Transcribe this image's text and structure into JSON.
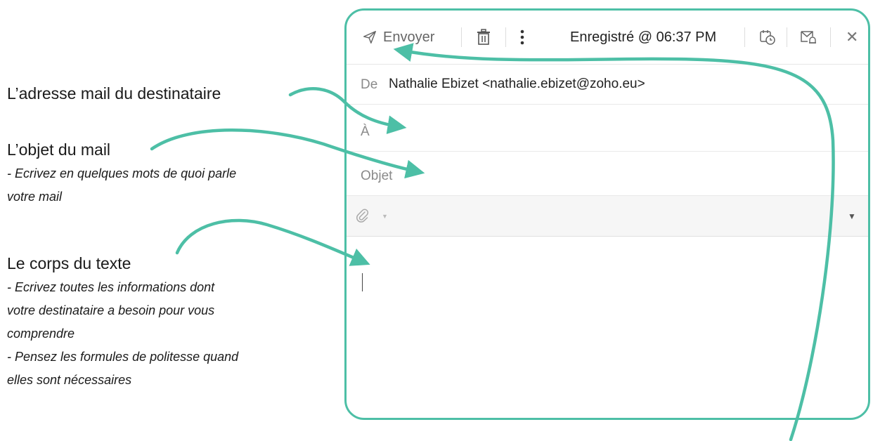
{
  "notes": {
    "recipient": {
      "title": "L’adresse mail du destinataire"
    },
    "subject": {
      "title": "L’objet du mail",
      "lines": [
        "- Ecrivez en quelques mots de quoi parle",
        "votre mail"
      ]
    },
    "body": {
      "title": "Le corps du texte",
      "lines": [
        "- Ecrivez toutes les informations dont",
        "votre destinataire a besoin pour vous",
        "comprendre",
        "- Pensez les formules de politesse quand",
        "elles sont nécessaires"
      ]
    }
  },
  "compose": {
    "toolbar": {
      "send_label": "Envoyer",
      "saved_status": "Enregistré @ 06:37 PM"
    },
    "from": {
      "label": "De",
      "value": "Nathalie Ebizet <nathalie.ebizet@zoho.eu>"
    },
    "to": {
      "label": "À",
      "value": ""
    },
    "subject": {
      "label": "Objet",
      "value": ""
    },
    "body": {
      "value": ""
    }
  },
  "colors": {
    "accent": "#4dbfa6",
    "muted_text": "#8a8a8a"
  },
  "icons": [
    "send-icon",
    "trash-icon",
    "more-vertical-icon",
    "schedule-icon",
    "reminder-icon",
    "close-icon",
    "paperclip-icon",
    "chevron-down-icon"
  ]
}
